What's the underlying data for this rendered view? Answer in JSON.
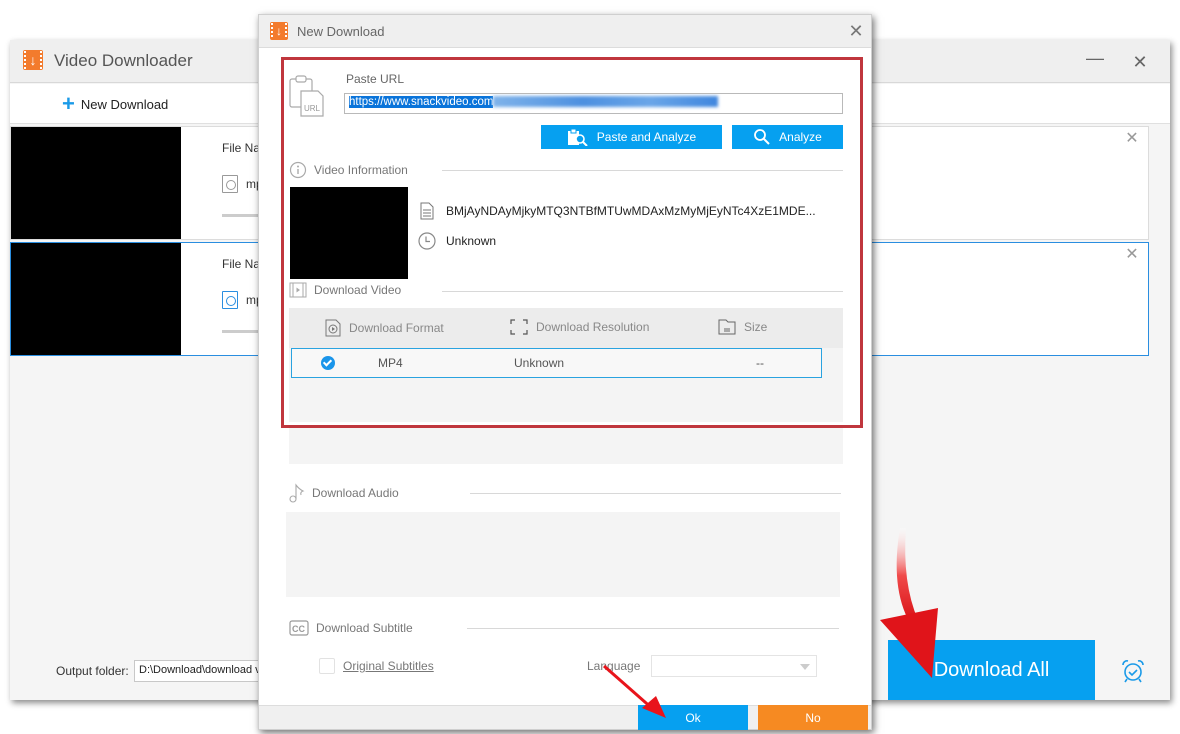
{
  "main_window": {
    "title": "Video Downloader",
    "toolbar": {
      "new_download_label": "New Download"
    },
    "tasks": [
      {
        "file_name_label": "File Na",
        "format": "mp",
        "selected": false
      },
      {
        "file_name_label": "File Na",
        "format": "mp",
        "selected": true
      }
    ],
    "footer": {
      "output_folder_label": "Output folder:",
      "output_folder_value": "D:\\Download\\download v",
      "download_all_label": "Download All"
    }
  },
  "dialog": {
    "title": "New Download",
    "paste_url_label": "Paste URL",
    "url_value_visible": "https://www.snackvideo.com",
    "paste_and_analyze_label": "Paste and Analyze",
    "analyze_label": "Analyze",
    "video_information": {
      "heading": "Video Information",
      "file_name": "BMjAyNDAyMjkyMTQ3NTBfMTUwMDAxMzMyMjEyNTc4XzE1MDE...",
      "duration": "Unknown"
    },
    "download_video": {
      "heading": "Download Video",
      "columns": [
        "Download Format",
        "Download Resolution",
        "Size"
      ],
      "rows": [
        {
          "format": "MP4",
          "resolution": "Unknown",
          "size": "--",
          "selected": true
        }
      ]
    },
    "download_audio": {
      "heading": "Download Audio"
    },
    "download_subtitle": {
      "heading": "Download Subtitle",
      "original_subtitles_label": "Original Subtitles",
      "original_subtitles_checked": false,
      "language_label": "Language",
      "language_value": ""
    },
    "ok_label": "Ok",
    "no_label": "No"
  },
  "colors": {
    "accent_blue": "#06a0f0",
    "cancel_orange": "#f68a22",
    "brand_orange": "#f37b2d",
    "highlight_red": "#c0363d",
    "annotation_red": "#e8141b"
  }
}
